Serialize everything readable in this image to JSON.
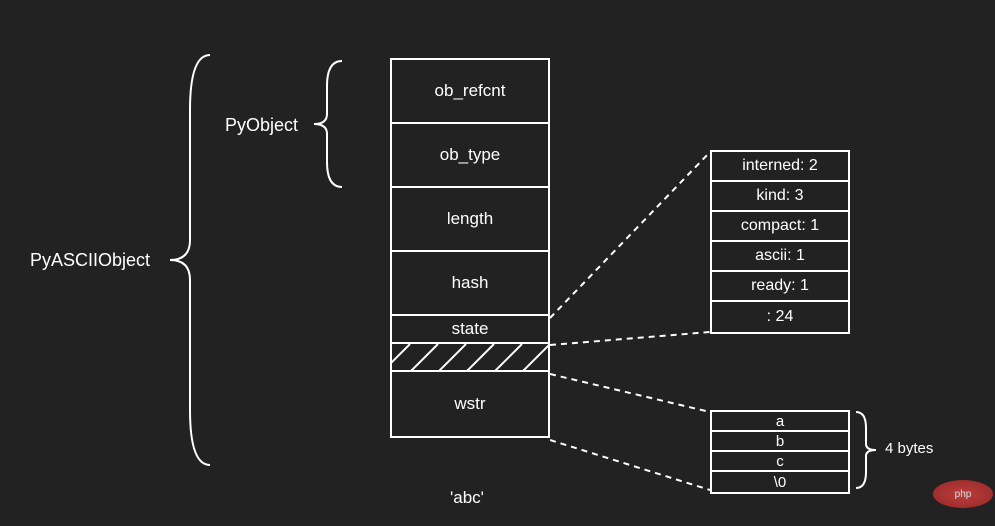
{
  "labels": {
    "outer": "PyASCIIObject",
    "inner": "PyObject",
    "footer": "'abc'",
    "bytesLabel": "4 bytes",
    "watermark": "php"
  },
  "struct": {
    "ob_refcnt": "ob_refcnt",
    "ob_type": "ob_type",
    "length": "length",
    "hash": "hash",
    "state": "state",
    "wstr": "wstr"
  },
  "state": {
    "interned": "interned: 2",
    "kind": "kind: 3",
    "compact": "compact: 1",
    "ascii": "ascii: 1",
    "ready": "ready: 1",
    "pad": ": 24"
  },
  "bytes": {
    "b0": "a",
    "b1": "b",
    "b2": "c",
    "b3": "\\0"
  }
}
